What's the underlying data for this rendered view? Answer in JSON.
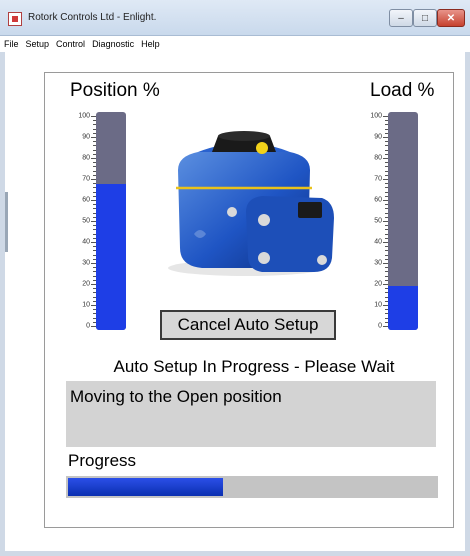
{
  "window": {
    "title": "Rotork Controls Ltd - Enlight."
  },
  "menu": [
    "File",
    "Setup",
    "Control",
    "Diagnostic",
    "Help"
  ],
  "position_gauge": {
    "title": "Position %",
    "value_percent": 67
  },
  "load_gauge": {
    "title": "Load %",
    "value_percent": 20
  },
  "scale_ticks": [
    "100",
    "90",
    "80",
    "70",
    "60",
    "50",
    "40",
    "30",
    "20",
    "10",
    "0"
  ],
  "actions": {
    "cancel_label": "Cancel Auto Setup"
  },
  "status": {
    "headline": "Auto Setup In Progress - Please Wait",
    "message": "Moving to the Open position"
  },
  "progress": {
    "label": "Progress",
    "value_fraction": 0.42
  },
  "colors": {
    "bar_fill": "#1e3ee6",
    "bar_track": "#6b6b86",
    "message_bg": "#d3d3d3"
  },
  "icons": {
    "actuator_image": "rotork-actuator-icon"
  }
}
